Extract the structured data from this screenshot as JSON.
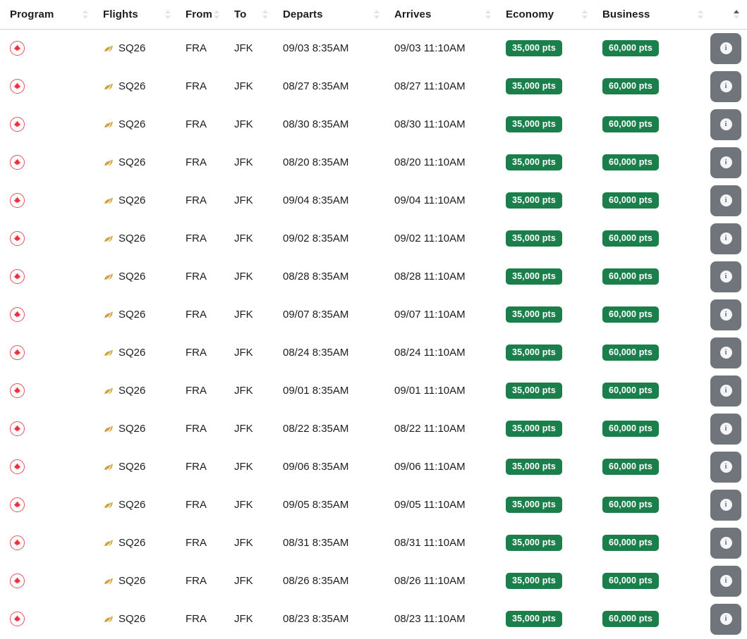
{
  "table": {
    "columns": [
      {
        "key": "program",
        "label": "Program",
        "sort": "none"
      },
      {
        "key": "flights",
        "label": "Flights",
        "sort": "none"
      },
      {
        "key": "from",
        "label": "From",
        "sort": "none"
      },
      {
        "key": "to",
        "label": "To",
        "sort": "none"
      },
      {
        "key": "departs",
        "label": "Departs",
        "sort": "none"
      },
      {
        "key": "arrives",
        "label": "Arrives",
        "sort": "none"
      },
      {
        "key": "economy",
        "label": "Economy",
        "sort": "none"
      },
      {
        "key": "business",
        "label": "Business",
        "sort": "none"
      },
      {
        "key": "action",
        "label": "",
        "sort": "asc"
      }
    ],
    "program_logo": "air-canada-aeroplan-logo",
    "airline_logo": "singapore-airlines-logo",
    "info_icon": "info-icon",
    "colors": {
      "badge_green": "#1a7f4b",
      "badge_text": "#ffffff",
      "info_button": "#6f757b",
      "program_logo_red": "#e8505a",
      "airline_logo_gold": "#d2a23c",
      "header_text": "#1b1d1f",
      "header_border": "#cfd2d5",
      "sort_inactive": "#e2e4e6",
      "sort_active": "#55585c"
    },
    "rows": [
      {
        "flight": "SQ26",
        "from": "FRA",
        "to": "JFK",
        "departs": "09/03 8:35AM",
        "arrives": "09/03 11:10AM",
        "economy": "35,000 pts",
        "business": "60,000 pts"
      },
      {
        "flight": "SQ26",
        "from": "FRA",
        "to": "JFK",
        "departs": "08/27 8:35AM",
        "arrives": "08/27 11:10AM",
        "economy": "35,000 pts",
        "business": "60,000 pts"
      },
      {
        "flight": "SQ26",
        "from": "FRA",
        "to": "JFK",
        "departs": "08/30 8:35AM",
        "arrives": "08/30 11:10AM",
        "economy": "35,000 pts",
        "business": "60,000 pts"
      },
      {
        "flight": "SQ26",
        "from": "FRA",
        "to": "JFK",
        "departs": "08/20 8:35AM",
        "arrives": "08/20 11:10AM",
        "economy": "35,000 pts",
        "business": "60,000 pts"
      },
      {
        "flight": "SQ26",
        "from": "FRA",
        "to": "JFK",
        "departs": "09/04 8:35AM",
        "arrives": "09/04 11:10AM",
        "economy": "35,000 pts",
        "business": "60,000 pts"
      },
      {
        "flight": "SQ26",
        "from": "FRA",
        "to": "JFK",
        "departs": "09/02 8:35AM",
        "arrives": "09/02 11:10AM",
        "economy": "35,000 pts",
        "business": "60,000 pts"
      },
      {
        "flight": "SQ26",
        "from": "FRA",
        "to": "JFK",
        "departs": "08/28 8:35AM",
        "arrives": "08/28 11:10AM",
        "economy": "35,000 pts",
        "business": "60,000 pts"
      },
      {
        "flight": "SQ26",
        "from": "FRA",
        "to": "JFK",
        "departs": "09/07 8:35AM",
        "arrives": "09/07 11:10AM",
        "economy": "35,000 pts",
        "business": "60,000 pts"
      },
      {
        "flight": "SQ26",
        "from": "FRA",
        "to": "JFK",
        "departs": "08/24 8:35AM",
        "arrives": "08/24 11:10AM",
        "economy": "35,000 pts",
        "business": "60,000 pts"
      },
      {
        "flight": "SQ26",
        "from": "FRA",
        "to": "JFK",
        "departs": "09/01 8:35AM",
        "arrives": "09/01 11:10AM",
        "economy": "35,000 pts",
        "business": "60,000 pts"
      },
      {
        "flight": "SQ26",
        "from": "FRA",
        "to": "JFK",
        "departs": "08/22 8:35AM",
        "arrives": "08/22 11:10AM",
        "economy": "35,000 pts",
        "business": "60,000 pts"
      },
      {
        "flight": "SQ26",
        "from": "FRA",
        "to": "JFK",
        "departs": "09/06 8:35AM",
        "arrives": "09/06 11:10AM",
        "economy": "35,000 pts",
        "business": "60,000 pts"
      },
      {
        "flight": "SQ26",
        "from": "FRA",
        "to": "JFK",
        "departs": "09/05 8:35AM",
        "arrives": "09/05 11:10AM",
        "economy": "35,000 pts",
        "business": "60,000 pts"
      },
      {
        "flight": "SQ26",
        "from": "FRA",
        "to": "JFK",
        "departs": "08/31 8:35AM",
        "arrives": "08/31 11:10AM",
        "economy": "35,000 pts",
        "business": "60,000 pts"
      },
      {
        "flight": "SQ26",
        "from": "FRA",
        "to": "JFK",
        "departs": "08/26 8:35AM",
        "arrives": "08/26 11:10AM",
        "economy": "35,000 pts",
        "business": "60,000 pts"
      },
      {
        "flight": "SQ26",
        "from": "FRA",
        "to": "JFK",
        "departs": "08/23 8:35AM",
        "arrives": "08/23 11:10AM",
        "economy": "35,000 pts",
        "business": "60,000 pts"
      }
    ]
  }
}
